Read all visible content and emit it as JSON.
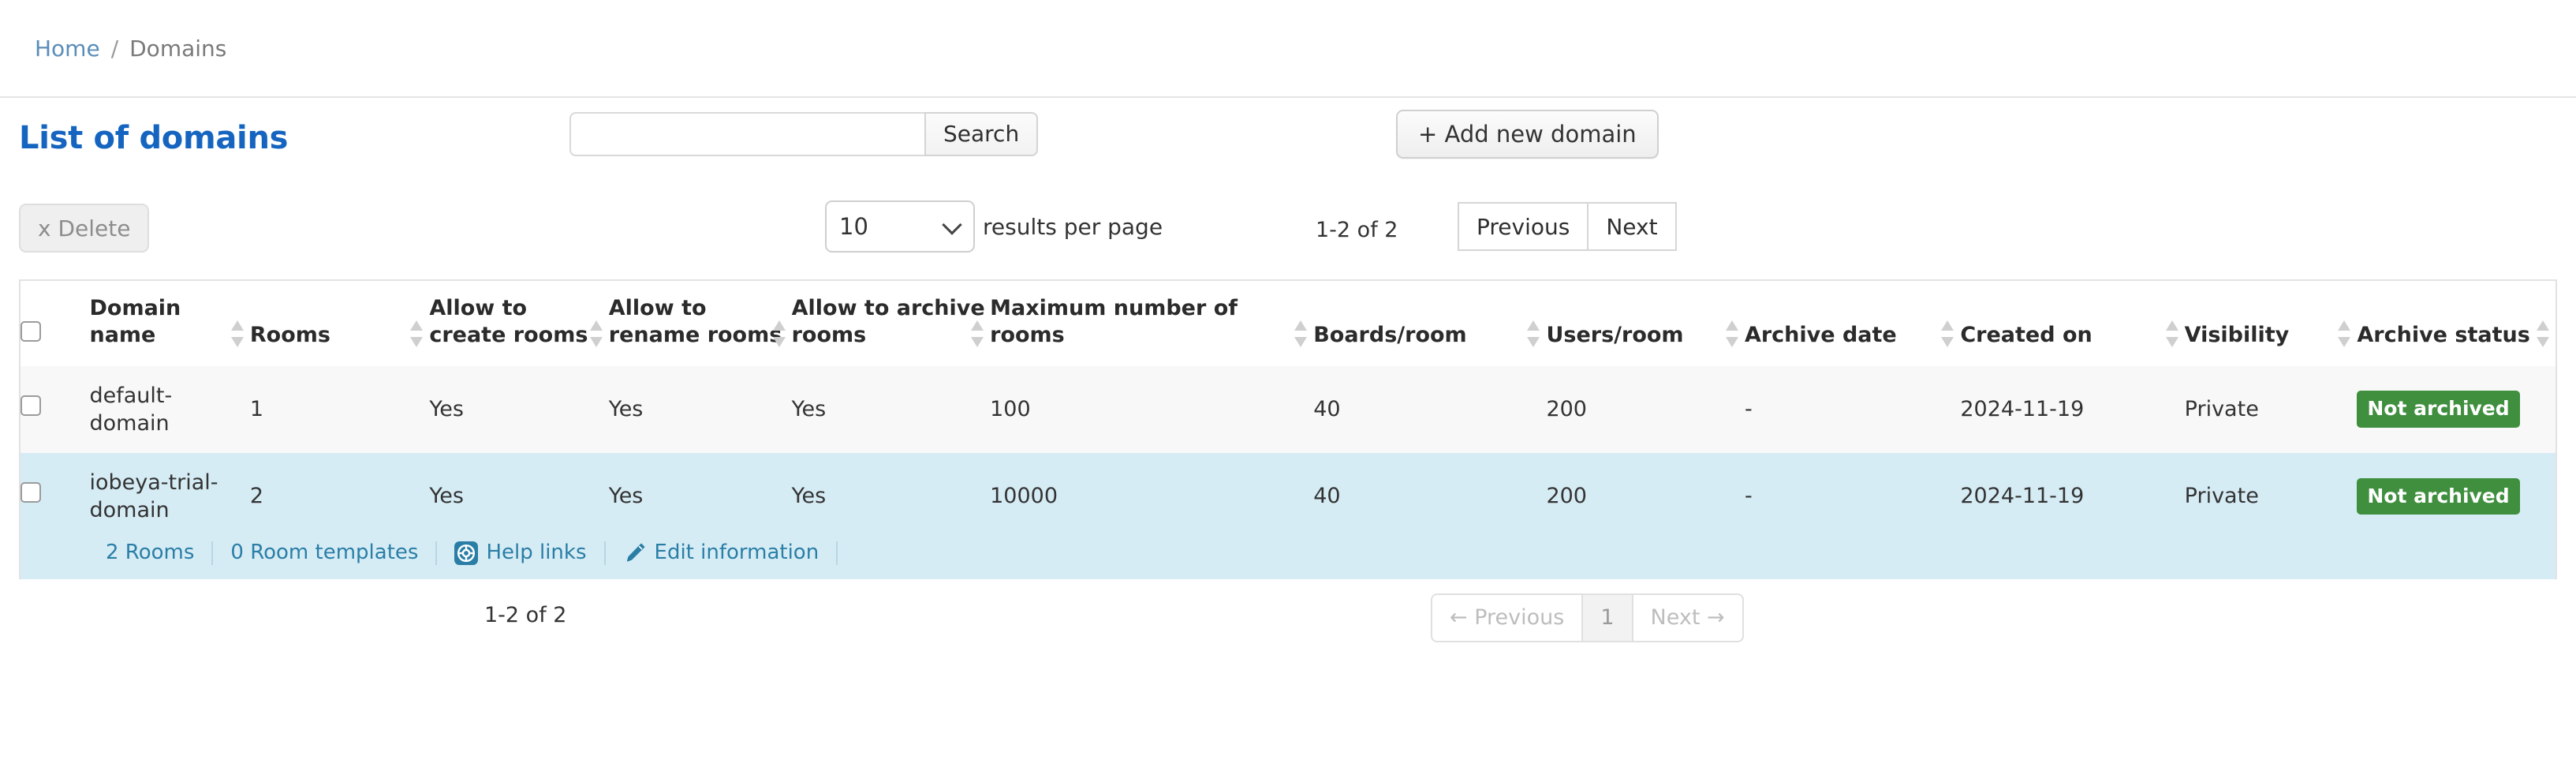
{
  "breadcrumb": {
    "home": "Home",
    "separator": "/",
    "current": "Domains"
  },
  "toolbar": {
    "page_title": "List of domains",
    "search_value": "",
    "search_placeholder": "",
    "search_button": "Search",
    "add_button": "+ Add new domain"
  },
  "controls": {
    "delete_button": "x Delete",
    "per_page_value": "10",
    "per_page_label": "results per page",
    "range_text": "1-2 of 2",
    "previous_button": "Previous",
    "next_button": "Next"
  },
  "table": {
    "columns": [
      {
        "label": "Domain name"
      },
      {
        "label": "Rooms"
      },
      {
        "label": "Allow to create rooms"
      },
      {
        "label": "Allow to rename rooms"
      },
      {
        "label": "Allow to archive rooms"
      },
      {
        "label": "Maximum number of rooms"
      },
      {
        "label": "Boards/room"
      },
      {
        "label": "Users/room"
      },
      {
        "label": "Archive date"
      },
      {
        "label": "Created on"
      },
      {
        "label": "Visibility"
      },
      {
        "label": "Archive status"
      }
    ],
    "rows": [
      {
        "name": "default-domain",
        "rooms": "1",
        "allow_create": "Yes",
        "allow_rename": "Yes",
        "allow_archive": "Yes",
        "max_rooms": "100",
        "boards_per_room": "40",
        "users_per_room": "200",
        "archive_date": "-",
        "created_on": "2024-11-19",
        "visibility": "Private",
        "archive_status": "Not archived"
      },
      {
        "name": "iobeya-trial-domain",
        "rooms": "2",
        "allow_create": "Yes",
        "allow_rename": "Yes",
        "allow_archive": "Yes",
        "max_rooms": "10000",
        "boards_per_room": "40",
        "users_per_room": "200",
        "archive_date": "-",
        "created_on": "2024-11-19",
        "visibility": "Private",
        "archive_status": "Not archived"
      }
    ],
    "row_actions": {
      "rooms_link": "2 Rooms",
      "templates_link": "0 Room templates",
      "help_links": "Help links",
      "edit_information": "Edit information"
    }
  },
  "footer": {
    "range_text": "1-2 of 2",
    "previous": "← Previous",
    "page_one": "1",
    "next": "Next →"
  },
  "colors": {
    "title_blue": "#1565c0",
    "link_blue": "#2a7ea6",
    "breadcrumb_link": "#5a8db8",
    "selected_row": "#d6ecf5",
    "badge_green": "#3f8f3f"
  }
}
